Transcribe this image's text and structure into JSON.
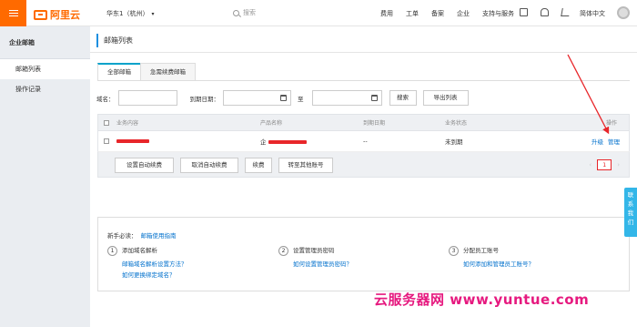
{
  "topbar": {
    "brand": "阿里云",
    "region": "华东1（杭州）",
    "search_placeholder": "搜索",
    "nav": [
      "费用",
      "工单",
      "备案",
      "企业",
      "支持与服务"
    ],
    "icons": [
      "monitor-icon",
      "bell-icon",
      "cart-icon"
    ],
    "lang": "简体中文"
  },
  "sidebar": {
    "title": "企业邮箱",
    "items": [
      {
        "label": "邮箱列表",
        "active": true
      },
      {
        "label": "操作记录",
        "active": false
      }
    ]
  },
  "main": {
    "title": "邮箱列表",
    "tabs": [
      {
        "label": "全部邮箱",
        "active": true
      },
      {
        "label": "急需续费邮箱",
        "active": false
      }
    ],
    "filters": {
      "domain_label": "域名：",
      "expire_label": "到期日期：",
      "to_label": "至",
      "search_btn": "搜索",
      "export_btn": "导出列表"
    },
    "table": {
      "headers": [
        "业务内容",
        "产品名称",
        "到期日期",
        "业务状态",
        "操作"
      ],
      "rows": [
        {
          "content": "",
          "product": "企",
          "expire": "--",
          "status": "未到期",
          "actions": [
            "升级",
            "管理"
          ]
        }
      ],
      "footer_buttons": [
        "设置自动续费",
        "取消自动续费",
        "续费",
        "转至其他账号"
      ],
      "page": "1"
    },
    "guide": {
      "title": "新手必读：",
      "title_link": "邮箱使用指南",
      "steps": [
        {
          "num": "1",
          "title": "添加域名解析",
          "links": [
            "邮箱域名解析设置方法？",
            "如何更换绑定域名？"
          ]
        },
        {
          "num": "2",
          "title": "设置管理员密码",
          "links": [
            "如何设置管理员密码？"
          ]
        },
        {
          "num": "3",
          "title": "分配员工账号",
          "links": [
            "如何添加和管理员工账号？"
          ]
        }
      ]
    }
  },
  "float_tab": "联系我们",
  "watermark": "云服务器网 www.yuntue.com",
  "colors": {
    "brand": "#ff6a00",
    "link": "#0070cc",
    "accent": "#00a2ca",
    "annotation": "#e8262a"
  }
}
